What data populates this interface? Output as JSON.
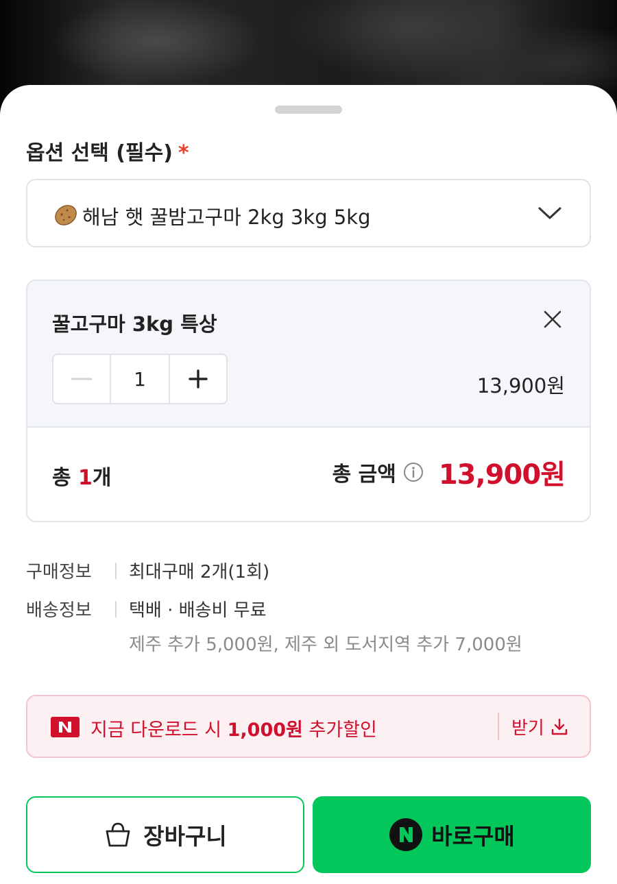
{
  "sheet": {
    "section_title": "옵션 선택 (필수)",
    "required_mark": "*",
    "option_select": {
      "icon": "potato-icon",
      "selected_value": "해남 햇 꿀밤고구마 2kg 3kg 5kg"
    }
  },
  "order": {
    "item_name": "꿀고구마 3kg 특상",
    "quantity": "1",
    "item_price": "13,900원",
    "total_count_prefix": "총 ",
    "total_count_number": "1",
    "total_count_suffix": "개",
    "total_amount_label": "총 금액",
    "total_amount_value": "13,900원"
  },
  "purchase_info": {
    "purchase_label": "구매정보",
    "purchase_value": "최대구매 2개(1회)",
    "shipping_label": "배송정보",
    "shipping_value": "택배 · 배송비 무료",
    "shipping_extra": "제주 추가 5,000원, 제주 외 도서지역 추가 7,000원"
  },
  "coupon": {
    "badge": "N",
    "text_prefix": "지금 다운로드 시 ",
    "text_amount": "1,000원",
    "text_suffix": " 추가할인",
    "receive_label": "받기"
  },
  "actions": {
    "cart_label": "장바구니",
    "buy_badge": "N",
    "buy_label": "바로구매"
  },
  "colors": {
    "accent_red": "#d0102d",
    "naver_green": "#03c75a",
    "coupon_bg": "#fdf0f2",
    "order_bg": "#f4f6fa"
  }
}
